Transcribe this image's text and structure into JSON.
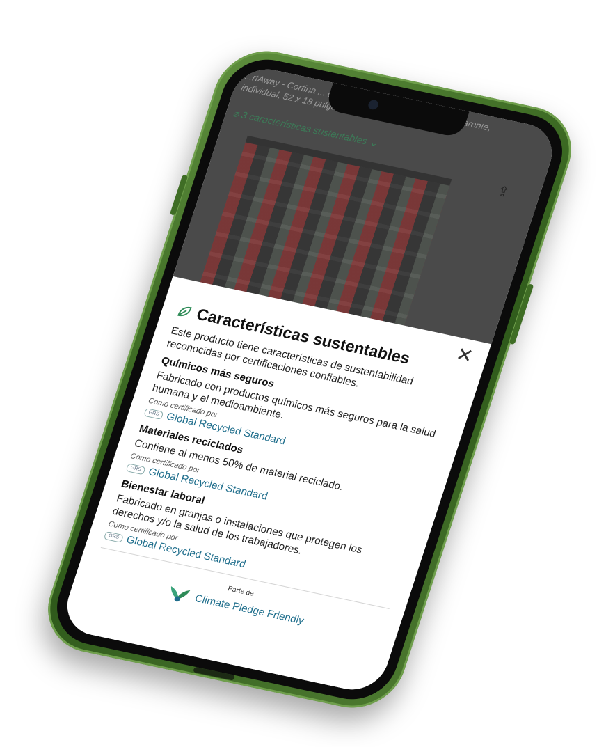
{
  "product": {
    "title": "...rtAway - Cortina ... con bolsillo para barra, semitransparente, individual, 52 x 18 pulgadas ... cocina,",
    "badge": "3 características sustentables"
  },
  "panel": {
    "title": "Características sustentables",
    "intro": "Este producto tiene características de sustentabilidad reconocidas por certificaciones confiables.",
    "sections": [
      {
        "heading": "Químicos más seguros",
        "text": "Fabricado con productos químicos más seguros para la salud humana y el medioambiente.",
        "certified_by": "Como certificado por",
        "cert_icon": "GRS",
        "cert": "Global Recycled Standard"
      },
      {
        "heading": "Materiales reciclados",
        "text": "Contiene al menos 50% de material reciclado.",
        "certified_by": "Como certificado por",
        "cert_icon": "GRS",
        "cert": "Global Recycled Standard"
      },
      {
        "heading": "Bienestar laboral",
        "text": "Fabricado en granjas o instalaciones que protegen los derechos y/o la salud de los trabajadores.",
        "certified_by": "Como certificado por",
        "cert_icon": "GRS",
        "cert": "Global Recycled Standard"
      }
    ],
    "footer": {
      "parte_de": "Parte de",
      "program": "Climate Pledge Friendly"
    },
    "close_icon": "close-icon"
  },
  "colors": {
    "phone_green": "#3d6b24",
    "link_teal": "#1f6e8c",
    "leaf_green": "#2e8b57"
  }
}
